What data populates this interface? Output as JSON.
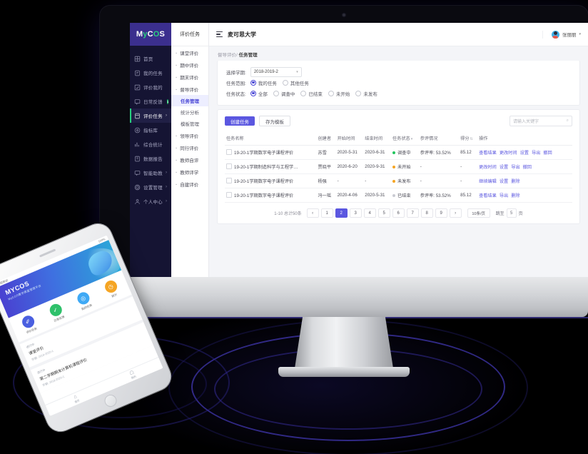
{
  "brand": {
    "name_a": "M",
    "name_y": "y",
    "name_c": "C",
    "name_o": "O",
    "name_s": "S",
    "full": "MyCOS"
  },
  "sidebar_primary": {
    "items": [
      {
        "label": "首页",
        "icon": "home-icon",
        "arrow": "",
        "badge": ""
      },
      {
        "label": "我的任务",
        "icon": "tasks-icon",
        "arrow": "",
        "badge": ""
      },
      {
        "label": "评价我的",
        "icon": "evaluate-icon",
        "arrow": "",
        "badge": ""
      },
      {
        "label": "日常反馈",
        "icon": "feedback-icon",
        "arrow": "",
        "badge": "1"
      },
      {
        "label": "评价任务",
        "icon": "clipboard-icon",
        "arrow": "›",
        "badge": ""
      },
      {
        "label": "指标库",
        "icon": "target-icon",
        "arrow": "",
        "badge": ""
      },
      {
        "label": "综合统计",
        "icon": "chart-icon",
        "arrow": "",
        "badge": ""
      },
      {
        "label": "数据报告",
        "icon": "report-icon",
        "arrow": "",
        "badge": ""
      },
      {
        "label": "智能助教",
        "icon": "assistant-icon",
        "arrow": "›",
        "badge": ""
      },
      {
        "label": "设置管理",
        "icon": "gear-icon",
        "arrow": "›",
        "badge": ""
      },
      {
        "label": "个人中心",
        "icon": "user-icon",
        "arrow": "›",
        "badge": ""
      }
    ],
    "active_index": 4
  },
  "sidebar_secondary": {
    "header": "评价任务",
    "chevron": "⌄",
    "groups": [
      {
        "label": "课堂评价",
        "children": []
      },
      {
        "label": "期中评价",
        "children": []
      },
      {
        "label": "期末评价",
        "children": []
      },
      {
        "label": "督导评价",
        "children": [
          "任务管理",
          "统计分析",
          "模板管理"
        ],
        "active_child": "任务管理"
      },
      {
        "label": "领导评价",
        "children": []
      },
      {
        "label": "同行评价",
        "children": []
      },
      {
        "label": "教师自评",
        "children": []
      },
      {
        "label": "教师评学",
        "children": []
      },
      {
        "label": "自建评价",
        "children": []
      }
    ]
  },
  "topbar": {
    "menu_icon": "hamburger-icon",
    "university": "麦可思大学",
    "user_name": "张丽丽",
    "caret": "▾"
  },
  "breadcrumb": {
    "parent": "督导评价/",
    "current": "任务管理"
  },
  "filters": {
    "term_label": "选择学期:",
    "term_value": "2018-2019-2",
    "term_caret": "▾",
    "scope_label": "任务范围:",
    "scope_options": [
      {
        "label": "我的任务",
        "selected": true
      },
      {
        "label": "其他任务",
        "selected": false
      }
    ],
    "status_label": "任务状态:",
    "status_options": [
      {
        "label": "全部",
        "selected": true
      },
      {
        "label": "调查中",
        "selected": false
      },
      {
        "label": "已结束",
        "selected": false
      },
      {
        "label": "未开始",
        "selected": false
      },
      {
        "label": "未发布",
        "selected": false
      }
    ]
  },
  "toolbar": {
    "create_label": "创建任务",
    "template_label": "存为模板",
    "search_placeholder": "请输入关键字",
    "search_icon": "search-icon"
  },
  "table": {
    "columns": [
      "任务名称",
      "创建者",
      "开始时间",
      "结束时间",
      "任务状态",
      "参评情况",
      "得分",
      "操作"
    ],
    "sort_status": "▾",
    "sort_score": "⇅",
    "rows": [
      {
        "name": "19-20-1学期数字电子课程评价",
        "creator": "苏雪",
        "start": "2020-5-31",
        "end": "2020-6-31",
        "status": "调查中",
        "status_color": "green",
        "participation": "参评率: 53.52%",
        "score": "85.12",
        "actions": [
          "查看结果",
          "更改时间",
          "设置",
          "导出",
          "撤回"
        ]
      },
      {
        "name": "19-20-1学期制造科学与工程学院督导听评…",
        "creator": "贾晓平",
        "start": "2020-6-20",
        "end": "2020-9-31",
        "status": "未开始",
        "status_color": "orange",
        "participation": "-",
        "score": "-",
        "actions": [
          "更改时间",
          "设置",
          "导出",
          "撤回"
        ]
      },
      {
        "name": "19-20-1学期数字电子课程评价",
        "creator": "杨强",
        "start": "-",
        "end": "-",
        "status": "未发布",
        "status_color": "orange",
        "participation": "-",
        "score": "-",
        "actions": [
          "继续编辑",
          "设置",
          "删除"
        ]
      },
      {
        "name": "19-20-1学期数字电子课程评价",
        "creator": "冯一瑶",
        "start": "2020-4-06",
        "end": "2020-5-31",
        "status": "已结束",
        "status_color": "gray",
        "participation": "参评率: 53.52%",
        "score": "85.12",
        "actions": [
          "查看结果",
          "导出",
          "删除"
        ]
      }
    ]
  },
  "pagination": {
    "summary": "1-10 总计50条",
    "prev": "‹",
    "next": "›",
    "pages": [
      "1",
      "2",
      "3",
      "4",
      "5",
      "6",
      "7",
      "8",
      "9"
    ],
    "current": "2",
    "page_size": "10条/页",
    "jump_label": "跳至",
    "jump_value": "5",
    "jump_unit": "页"
  },
  "phone": {
    "status_left": "中国移动",
    "status_right": "100%",
    "hero_title": "MYCOS",
    "hero_sub": "MyCOS教学质量管理平台",
    "icons": [
      {
        "label": "评价任务",
        "glyph": "✐",
        "color": "#4a5fe0"
      },
      {
        "label": "日常反馈",
        "glyph": "✓",
        "color": "#2fc16b"
      },
      {
        "label": "我的任务",
        "glyph": "◎",
        "color": "#3fa9f5"
      },
      {
        "label": "统计",
        "glyph": "◷",
        "color": "#f5a524"
      }
    ],
    "cards": [
      {
        "tag": "进行中",
        "title": "课堂评价",
        "sub": "学期: 2019-2020-1"
      },
      {
        "tag": "进行中",
        "title": "第二学期期末计算机课程评价",
        "sub": "学期: 2019-2020-1"
      }
    ],
    "tabs": [
      {
        "label": "首页",
        "glyph": "⌂"
      },
      {
        "label": "我的",
        "glyph": "☖"
      }
    ]
  }
}
